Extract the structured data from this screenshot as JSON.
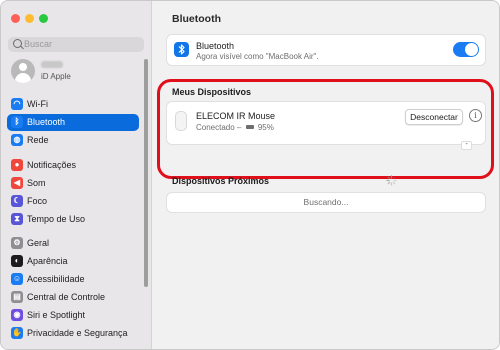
{
  "window": {
    "traffic_lights": [
      "#fe5f57",
      "#febc2e",
      "#28c840"
    ]
  },
  "search": {
    "placeholder": "Buscar"
  },
  "account": {
    "subtitle": "iD Apple"
  },
  "sidebar": {
    "items": [
      {
        "label": "Wi-Fi",
        "icon": "wifi-icon",
        "color": "#1a7cf2",
        "glyph": "◠"
      },
      {
        "label": "Bluetooth",
        "icon": "bluetooth-icon",
        "color": "#1a7cf2",
        "glyph": "ᛒ",
        "selected": true
      },
      {
        "label": "Rede",
        "icon": "globe-icon",
        "color": "#1a7cf2",
        "glyph": "◍"
      },
      {
        "label": "Notificações",
        "icon": "bell-icon",
        "color": "#f0463c",
        "glyph": "●"
      },
      {
        "label": "Som",
        "icon": "speaker-icon",
        "color": "#f0463c",
        "glyph": "◀"
      },
      {
        "label": "Foco",
        "icon": "moon-icon",
        "color": "#5856d6",
        "glyph": "☾"
      },
      {
        "label": "Tempo de Uso",
        "icon": "hourglass-icon",
        "color": "#5856d6",
        "glyph": "⧗"
      },
      {
        "label": "Geral",
        "icon": "gear-icon",
        "color": "#8e8e93",
        "glyph": "⚙"
      },
      {
        "label": "Aparência",
        "icon": "appearance-icon",
        "color": "#1c1c1e",
        "glyph": "◐"
      },
      {
        "label": "Acessibilidade",
        "icon": "accessibility-icon",
        "color": "#1a7cf2",
        "glyph": "☺"
      },
      {
        "label": "Central de Controle",
        "icon": "control-center-icon",
        "color": "#8e8e93",
        "glyph": "▤"
      },
      {
        "label": "Siri e Spotlight",
        "icon": "siri-icon",
        "color": "#6f4ee0",
        "glyph": "◉"
      },
      {
        "label": "Privacidade e Segurança",
        "icon": "hand-icon",
        "color": "#1a7cf2",
        "glyph": "✋"
      }
    ]
  },
  "main": {
    "title": "Bluetooth",
    "bluetooth": {
      "label": "Bluetooth",
      "subtitle": "Agora visível como \"MacBook Air\".",
      "enabled": true
    },
    "my_devices": {
      "title": "Meus Dispositivos",
      "device": {
        "name": "ELECOM IR Mouse",
        "status": "Conectado –",
        "battery": "95%",
        "disconnect_label": "Desconectar"
      },
      "extra_button": "-"
    },
    "nearby": {
      "title": "Dispositivos Próximos",
      "status": "Buscando..."
    }
  },
  "colors": {
    "accent": "#0a6cdc",
    "highlight_border": "#e0101a"
  }
}
